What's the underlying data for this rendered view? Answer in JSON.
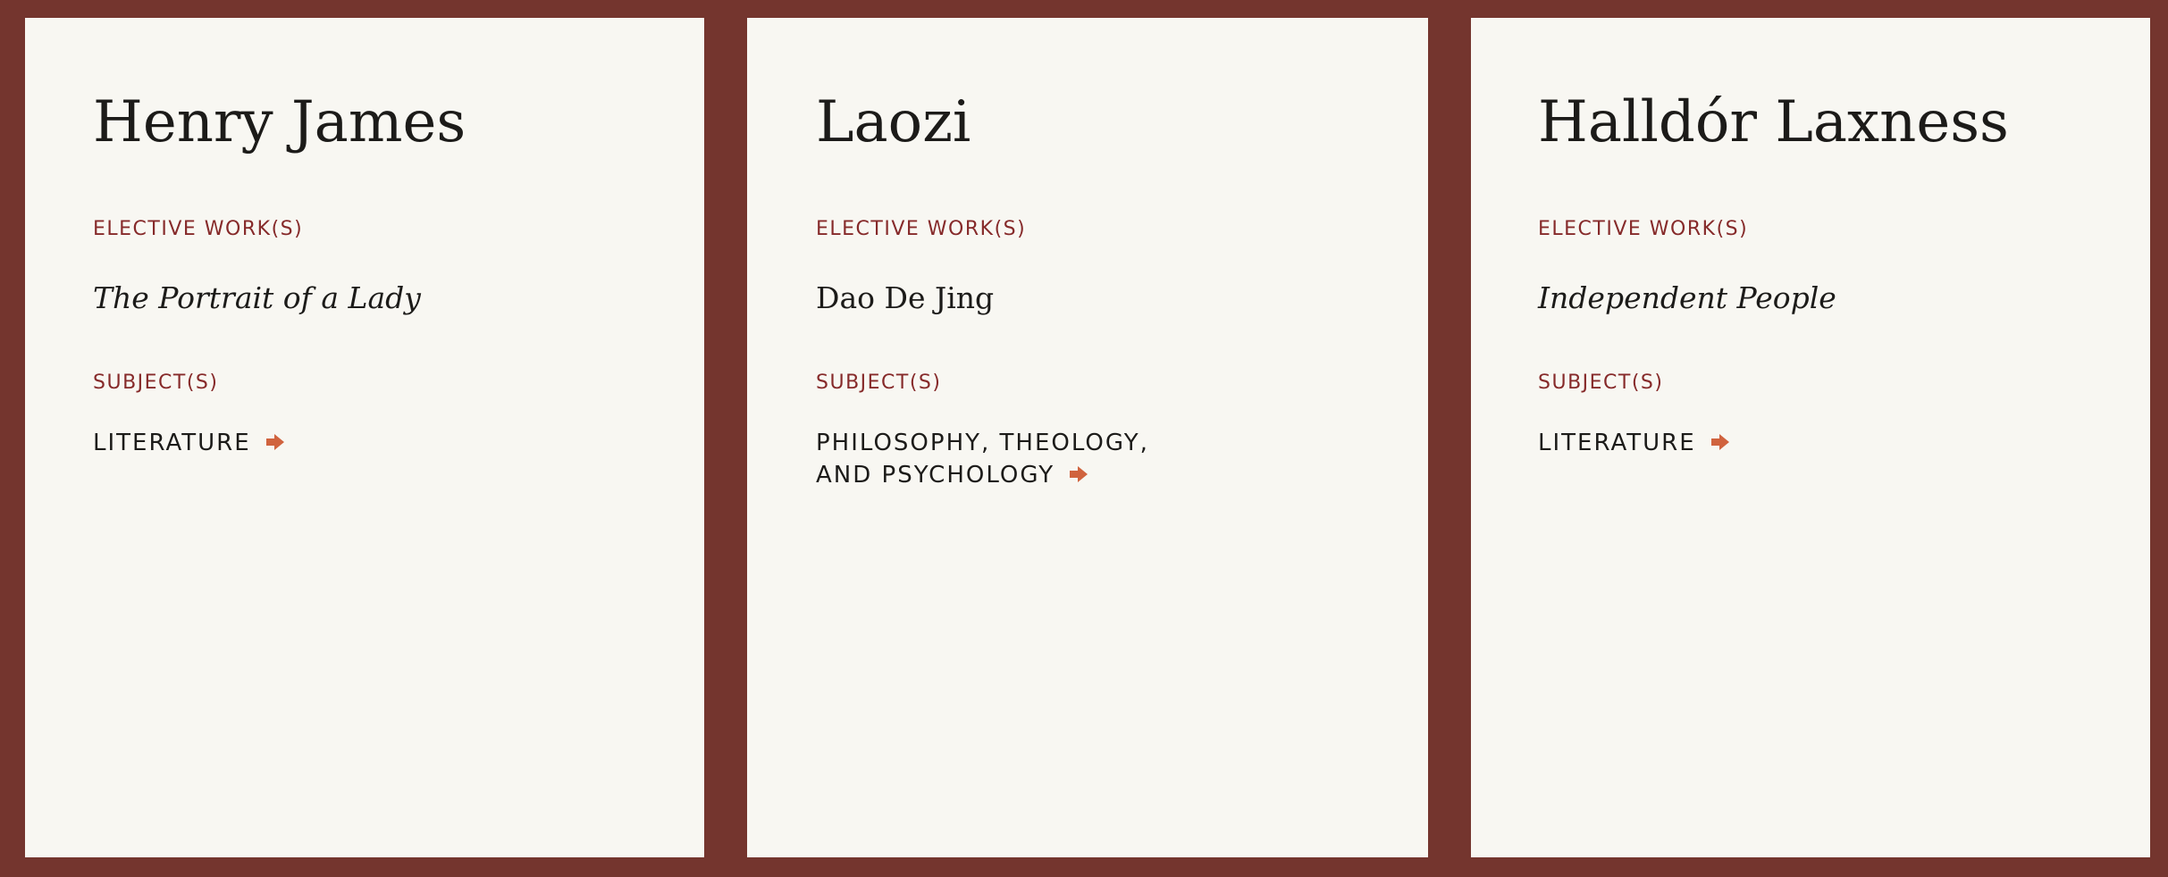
{
  "cards": [
    {
      "author": "Henry James",
      "works_label": "ELECTIVE WORK(S)",
      "work": "The Portrait of a Lady",
      "work_italic": true,
      "subjects_label": "SUBJECT(S)",
      "subject": "LITERATURE",
      "subject_icon": "arrow-right-icon"
    },
    {
      "author": "Laozi",
      "works_label": "ELECTIVE WORK(S)",
      "work": "Dao De Jing",
      "work_italic": false,
      "subjects_label": "SUBJECT(S)",
      "subject": "PHILOSOPHY, THEOLOGY, AND PSYCHOLOGY",
      "subject_icon": "arrow-right-icon"
    },
    {
      "author": "Halldór Laxness",
      "works_label": "ELECTIVE WORK(S)",
      "work": "Independent People",
      "work_italic": true,
      "subjects_label": "SUBJECT(S)",
      "subject": "LITERATURE",
      "subject_icon": "arrow-right-icon"
    }
  ],
  "colors": {
    "background": "#74352e",
    "card": "#f8f7f2",
    "label": "#862a2a",
    "arrow": "#d0633e",
    "text": "#1c1b19"
  }
}
